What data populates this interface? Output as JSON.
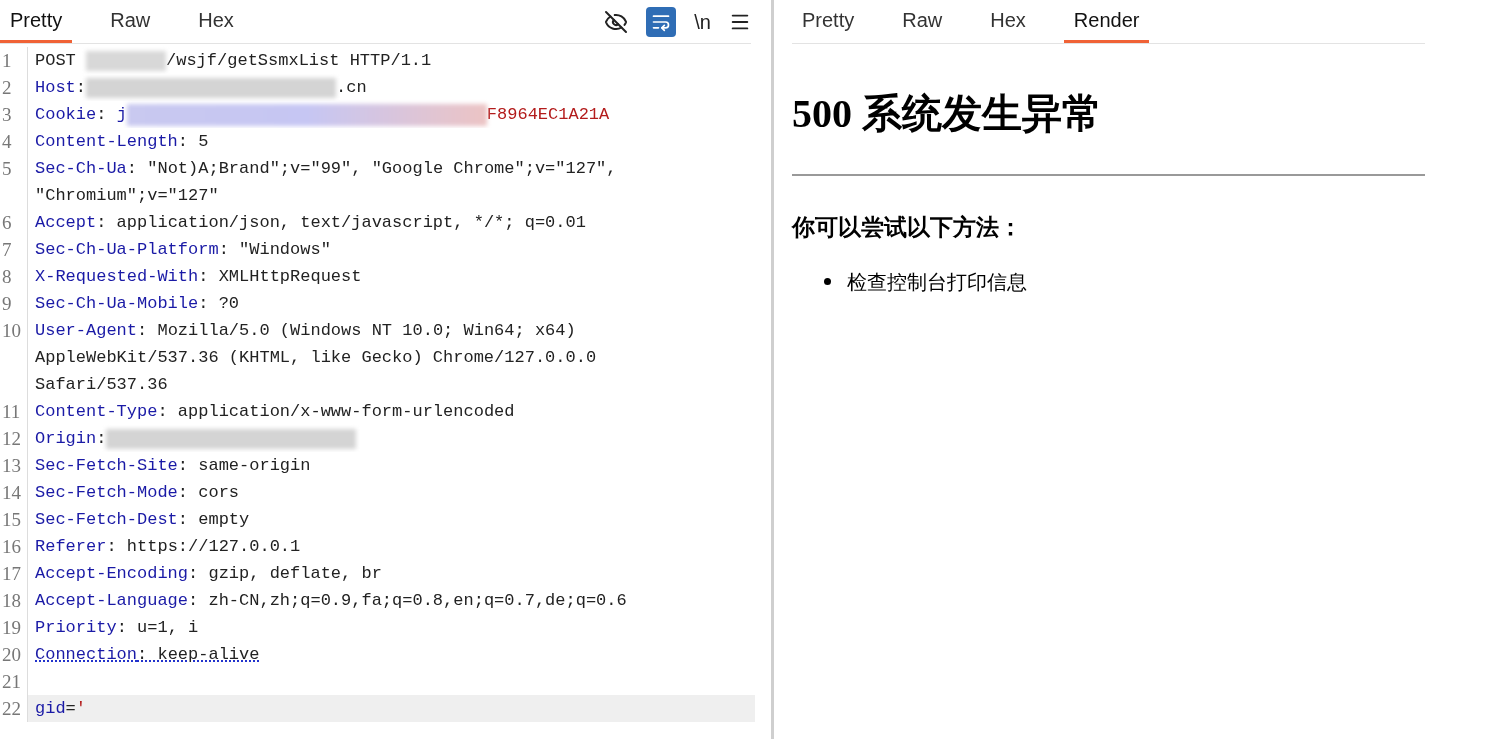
{
  "request": {
    "tabs": [
      {
        "label": "Pretty",
        "selected": true
      },
      {
        "label": "Raw",
        "selected": false
      },
      {
        "label": "Hex",
        "selected": false
      }
    ],
    "toolbar": {
      "wrap_on": true,
      "newline_label": "\\n"
    },
    "lines": [
      {
        "number": "1",
        "selected": false,
        "parts": [
          {
            "kind": "plain",
            "text": "POST "
          },
          {
            "kind": "redacted_short"
          },
          {
            "kind": "plain",
            "text": "/wsjf/getSsmxList HTTP/1.1"
          }
        ]
      },
      {
        "number": "2",
        "selected": false,
        "parts": [
          {
            "kind": "key",
            "text": "Host"
          },
          {
            "kind": "plain",
            "text": ":"
          },
          {
            "kind": "redacted_long"
          },
          {
            "kind": "plain",
            "text": ".cn"
          }
        ]
      },
      {
        "number": "3",
        "selected": false,
        "parts": [
          {
            "kind": "key",
            "text": "Cookie"
          },
          {
            "kind": "plain",
            "text": ": "
          },
          {
            "kind": "key",
            "text": "j"
          },
          {
            "kind": "redacted_cookie"
          },
          {
            "kind": "red",
            "text": "F8964EC1A21A"
          }
        ]
      },
      {
        "number": "4",
        "selected": false,
        "parts": [
          {
            "kind": "key",
            "text": "Content-Length"
          },
          {
            "kind": "plain",
            "text": ": 5"
          }
        ]
      },
      {
        "number": "5",
        "selected": false,
        "parts": [
          {
            "kind": "key",
            "text": "Sec-Ch-Ua"
          },
          {
            "kind": "plain",
            "text": ": \"Not)A;Brand\";v=\"99\", \"Google Chrome\";v=\"127\", \"Chromium\";v=\"127\""
          }
        ]
      },
      {
        "number": "6",
        "selected": false,
        "parts": [
          {
            "kind": "key",
            "text": "Accept"
          },
          {
            "kind": "plain",
            "text": ": application/json, text/javascript, */*; q=0.01"
          }
        ]
      },
      {
        "number": "7",
        "selected": false,
        "parts": [
          {
            "kind": "key",
            "text": "Sec-Ch-Ua-Platform"
          },
          {
            "kind": "plain",
            "text": ": \"Windows\""
          }
        ]
      },
      {
        "number": "8",
        "selected": false,
        "parts": [
          {
            "kind": "key",
            "text": "X-Requested-With"
          },
          {
            "kind": "plain",
            "text": ": XMLHttpRequest"
          }
        ]
      },
      {
        "number": "9",
        "selected": false,
        "parts": [
          {
            "kind": "key",
            "text": "Sec-Ch-Ua-Mobile"
          },
          {
            "kind": "plain",
            "text": ": ?0"
          }
        ]
      },
      {
        "number": "10",
        "selected": false,
        "parts": [
          {
            "kind": "key",
            "text": "User-Agent"
          },
          {
            "kind": "plain",
            "text": ": Mozilla/5.0 (Windows NT 10.0; Win64; x64) AppleWebKit/537.36 (KHTML, like Gecko) Chrome/127.0.0.0 Safari/537.36"
          }
        ]
      },
      {
        "number": "11",
        "selected": false,
        "parts": [
          {
            "kind": "key",
            "text": "Content-Type"
          },
          {
            "kind": "plain",
            "text": ": application/x-www-form-urlencoded"
          }
        ]
      },
      {
        "number": "12",
        "selected": false,
        "parts": [
          {
            "kind": "key",
            "text": "Origin"
          },
          {
            "kind": "plain",
            "text": ":"
          },
          {
            "kind": "redacted_long"
          }
        ]
      },
      {
        "number": "13",
        "selected": false,
        "parts": [
          {
            "kind": "key",
            "text": "Sec-Fetch-Site"
          },
          {
            "kind": "plain",
            "text": ": same-origin"
          }
        ]
      },
      {
        "number": "14",
        "selected": false,
        "parts": [
          {
            "kind": "key",
            "text": "Sec-Fetch-Mode"
          },
          {
            "kind": "plain",
            "text": ": cors"
          }
        ]
      },
      {
        "number": "15",
        "selected": false,
        "parts": [
          {
            "kind": "key",
            "text": "Sec-Fetch-Dest"
          },
          {
            "kind": "plain",
            "text": ": empty"
          }
        ]
      },
      {
        "number": "16",
        "selected": false,
        "parts": [
          {
            "kind": "key",
            "text": "Referer"
          },
          {
            "kind": "plain",
            "text": ": https://127.0.0.1"
          }
        ]
      },
      {
        "number": "17",
        "selected": false,
        "parts": [
          {
            "kind": "key",
            "text": "Accept-Encoding"
          },
          {
            "kind": "plain",
            "text": ": gzip, deflate, br"
          }
        ]
      },
      {
        "number": "18",
        "selected": false,
        "parts": [
          {
            "kind": "key",
            "text": "Accept-Language"
          },
          {
            "kind": "plain",
            "text": ": zh-CN,zh;q=0.9,fa;q=0.8,en;q=0.7,de;q=0.6"
          }
        ]
      },
      {
        "number": "19",
        "selected": false,
        "parts": [
          {
            "kind": "key",
            "text": "Priority"
          },
          {
            "kind": "plain",
            "text": ": u=1, i"
          }
        ]
      },
      {
        "number": "20",
        "selected": false,
        "parts": [
          {
            "kind": "key_flagged",
            "text": "Connection"
          },
          {
            "kind": "plain_flagged",
            "text": ": keep-alive"
          }
        ]
      },
      {
        "number": "21",
        "selected": false
      },
      {
        "number": "22",
        "selected": true,
        "parts": [
          {
            "kind": "key",
            "text": "gid"
          },
          {
            "kind": "plain",
            "text": "="
          },
          {
            "kind": "red",
            "text": "'"
          }
        ]
      }
    ]
  },
  "response": {
    "tabs": [
      {
        "label": "Pretty",
        "selected": false
      },
      {
        "label": "Raw",
        "selected": false
      },
      {
        "label": "Hex",
        "selected": false
      },
      {
        "label": "Render",
        "selected": true
      }
    ],
    "render": {
      "heading": "500 系统发生异常",
      "subheading": "你可以尝试以下方法：",
      "items": [
        "检查控制台打印信息"
      ]
    }
  }
}
